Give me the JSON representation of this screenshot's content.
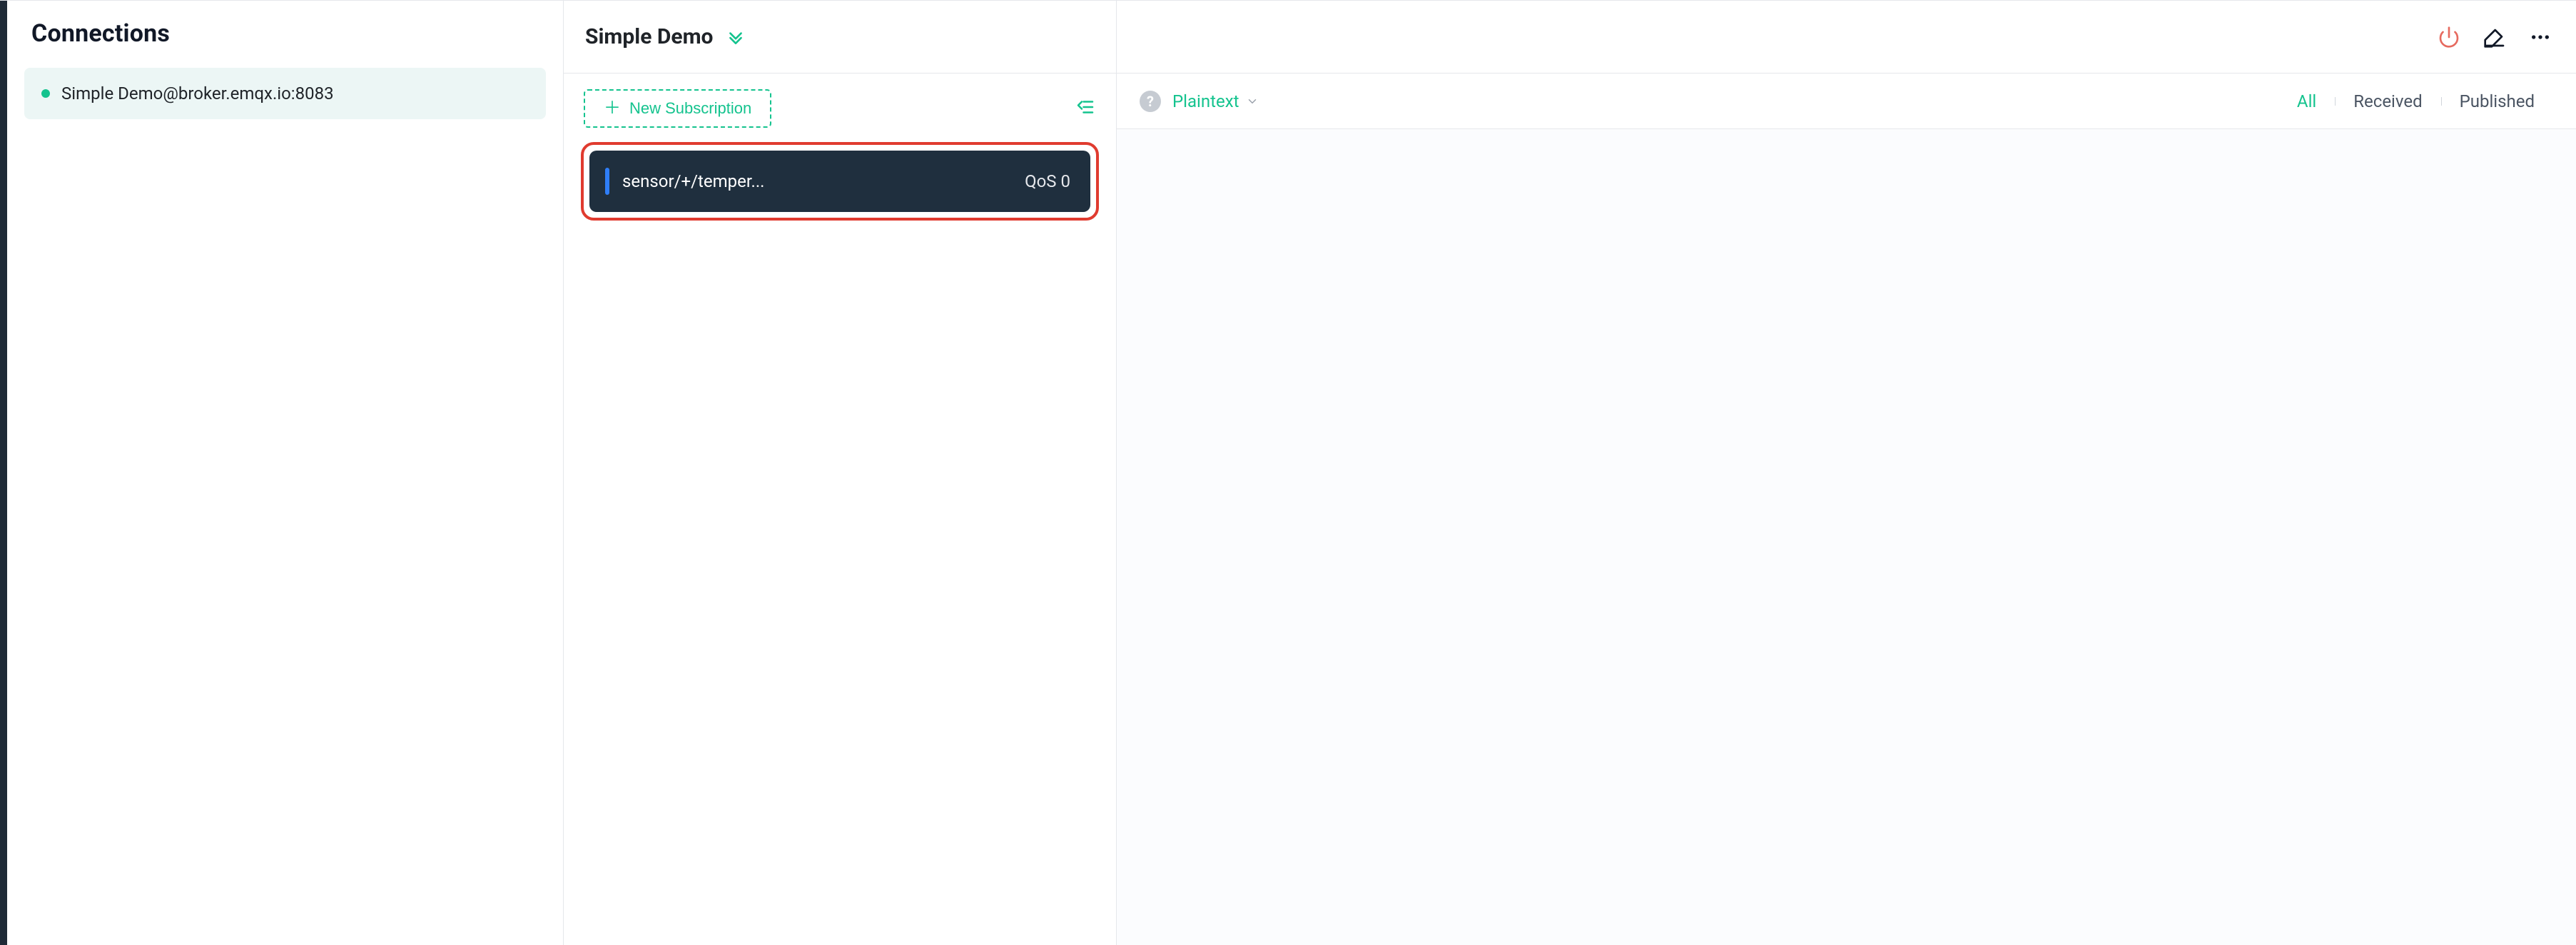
{
  "colors": {
    "accent": "#14c38e",
    "danger": "#e03b2f",
    "dark_nav": "#1f2a37",
    "card_bg": "#1f2f3e",
    "topic_color_bar": "#2f7ef7"
  },
  "connections_panel": {
    "title": "Connections",
    "items": [
      {
        "status": "online",
        "label": "Simple Demo@broker.emqx.io:8083"
      }
    ]
  },
  "header": {
    "connection_name": "Simple Demo",
    "actions": {
      "power_icon": "power-icon",
      "edit_icon": "edit-icon",
      "more_icon": "more-icon"
    }
  },
  "subscriptions": {
    "new_button_label": "New Subscription",
    "collapse_icon": "collapse-list-icon",
    "items": [
      {
        "topic": "sensor/+/temper...",
        "qos_label": "QoS 0",
        "highlighted": true
      }
    ]
  },
  "message_filter": {
    "help_icon": "?",
    "format_label": "Plaintext",
    "tabs": [
      {
        "label": "All",
        "active": true
      },
      {
        "label": "Received",
        "active": false
      },
      {
        "label": "Published",
        "active": false
      }
    ]
  }
}
